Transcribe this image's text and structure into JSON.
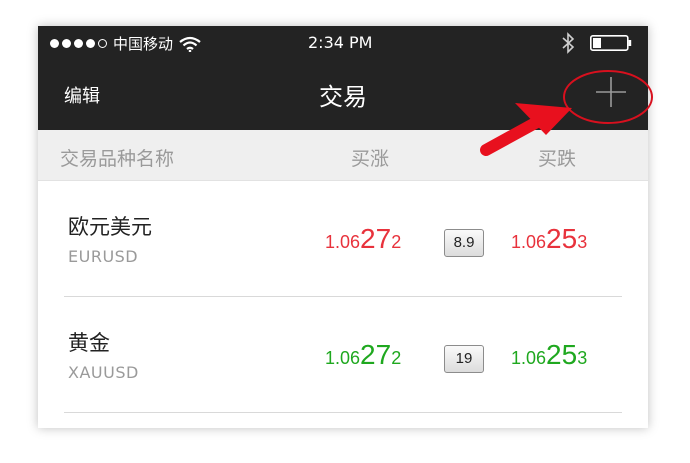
{
  "status_bar": {
    "carrier": "中国移动",
    "time": "2:34 PM",
    "signal_dots_filled": 4,
    "signal_dots_total": 5,
    "icons": [
      "wifi-icon",
      "bluetooth-icon",
      "battery-icon"
    ]
  },
  "nav": {
    "edit_label": "编辑",
    "title": "交易",
    "add_icon": "plus-icon"
  },
  "table": {
    "headers": {
      "name": "交易品种名称",
      "buy": "买涨",
      "sell": "买跌"
    },
    "rows": [
      {
        "name": "欧元美元",
        "code": "EURUSD",
        "buy": {
          "prefix": "1.06",
          "big": "27",
          "suffix": "2"
        },
        "spread": "8.9",
        "sell": {
          "prefix": "1.06",
          "big": "25",
          "suffix": "3"
        },
        "price_color": "#e8323c"
      },
      {
        "name": "黄金",
        "code": "XAUUSD",
        "buy": {
          "prefix": "1.06",
          "big": "27",
          "suffix": "2"
        },
        "spread": "19",
        "sell": {
          "prefix": "1.06",
          "big": "25",
          "suffix": "3"
        },
        "price_color": "#1fa81f"
      }
    ]
  },
  "annotation": {
    "arrow_color": "#e8101e",
    "circle_color": "#d8101e"
  },
  "colors": {
    "bar_bg": "#232323",
    "header_bg": "#efefef"
  }
}
